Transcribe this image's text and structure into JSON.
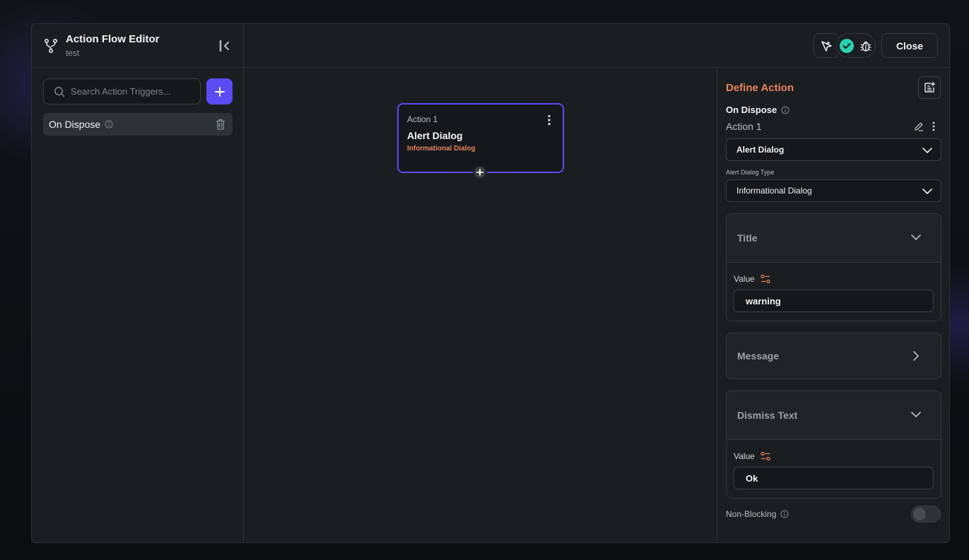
{
  "header": {
    "title": "Action Flow Editor",
    "subtitle": "test",
    "close_label": "Close"
  },
  "left": {
    "search_placeholder": "Search Action Triggers...",
    "triggers": [
      {
        "label": "On Dispose"
      }
    ]
  },
  "canvas": {
    "card": {
      "number": "Action 1",
      "name": "Alert Dialog",
      "type": "Informational Dialog"
    }
  },
  "right": {
    "title": "Define Action",
    "trigger": "On Dispose",
    "action_name": "Action 1",
    "action_select": "Alert Dialog",
    "dialog_type_label": "Alert Dialog Type",
    "dialog_type_select": "Informational Dialog",
    "sections": {
      "title": {
        "label": "Title",
        "value_label": "Value",
        "value": "warning"
      },
      "message": {
        "label": "Message"
      },
      "dismiss": {
        "label": "Dismiss Text",
        "value_label": "Value",
        "value": "Ok"
      }
    },
    "non_blocking_label": "Non-Blocking",
    "non_blocking": false
  },
  "colors": {
    "accent": "#5b4bf5",
    "orange": "#e8845c",
    "success": "#2ad1b0"
  }
}
